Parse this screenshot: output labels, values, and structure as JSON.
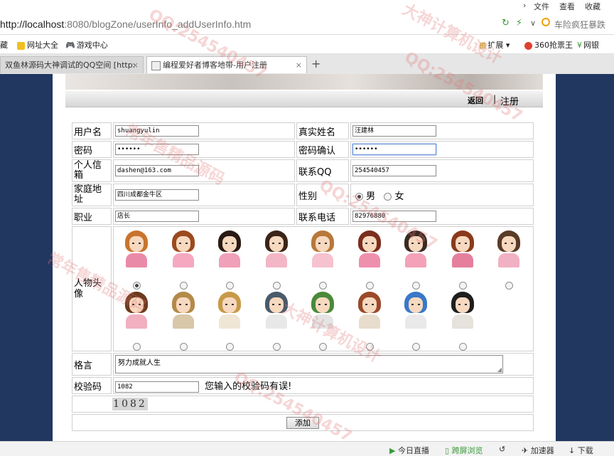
{
  "browser": {
    "menu": [
      "文件",
      "查看",
      "收藏"
    ],
    "url_host": "http://localhost",
    "url_rest": ":8080/blogZone/userInfo_addUserInfo.htm",
    "search_text": "车险疯狂暴跌",
    "bookmarks": [
      "藏",
      "网址大全",
      "游戏中心"
    ],
    "bookmarks_right": [
      "扩展",
      "360抢票王",
      "网银"
    ],
    "tabs": [
      {
        "label": "双鱼林源码大神调试的QQ空间 [http:",
        "active": false
      },
      {
        "label": "编程爱好者博客地带-用户注册",
        "active": true
      }
    ],
    "new_tab": "+"
  },
  "nav": {
    "back": "返回",
    "separator": "|",
    "register": "注册"
  },
  "form": {
    "username_label": "用户名",
    "username_value": "shuangyulin",
    "realname_label": "真实姓名",
    "realname_value": "汪建林",
    "password_label": "密码",
    "password_value": "••••••",
    "confirm_label": "密码确认",
    "confirm_value": "••••••",
    "email_label": "个人信箱",
    "email_value": "dashen@163.com",
    "qq_label": "联系QQ",
    "qq_value": "254540457",
    "address_label": "家庭地址",
    "address_value": "四川成都金牛区",
    "gender_label": "性别",
    "gender_male": "男",
    "gender_female": "女",
    "job_label": "职业",
    "job_value": "店长",
    "phone_label": "联系电话",
    "phone_value": "82976880",
    "avatar_label": "人物头像",
    "motto_label": "格言",
    "motto_value": "努力成就人生",
    "code_label": "校验码",
    "code_value": "1082",
    "code_error": "您输入的校验码有误!",
    "captcha_text": "1082",
    "submit_label": "添加"
  },
  "avatars": {
    "row1_count": 9,
    "row2_count": 8,
    "selected": 0,
    "colors": [
      {
        "hair": "#c8742e",
        "body": "#e98aa8"
      },
      {
        "hair": "#9b4a1e",
        "body": "#f5a8c0"
      },
      {
        "hair": "#2a1a14",
        "body": "#f0a0b8"
      },
      {
        "hair": "#3b2418",
        "body": "#f3b6c6"
      },
      {
        "hair": "#b8783a",
        "body": "#f6c2cf"
      },
      {
        "hair": "#7a2e1e",
        "body": "#ef8fae"
      },
      {
        "hair": "#3a2a22",
        "body": "#f3a2b8"
      },
      {
        "hair": "#8a3a1c",
        "body": "#e57f9d"
      },
      {
        "hair": "#5a3b26",
        "body": "#f1b0c3"
      },
      {
        "hair": "#6b3a1e",
        "body": "#f0b0c0"
      },
      {
        "hair": "#b48a4a",
        "body": "#d8c7a8"
      },
      {
        "hair": "#c79a48",
        "body": "#efe6d6"
      },
      {
        "hair": "#4a5a6a",
        "body": "#e8e8e8"
      },
      {
        "hair": "#4a8a3a",
        "body": "#e4e4e4"
      },
      {
        "hair": "#9a4a2a",
        "body": "#e8dccc"
      },
      {
        "hair": "#3a78c8",
        "body": "#e9e9ea"
      },
      {
        "hair": "#1e1e1e",
        "body": "#e6e2dc"
      }
    ]
  },
  "statusbar": [
    "今日直播",
    "跨屏浏览",
    "加速器",
    "下载"
  ],
  "watermarks": [
    "QQ:254540457",
    "常年售精品源码",
    "大神计算机设计"
  ]
}
